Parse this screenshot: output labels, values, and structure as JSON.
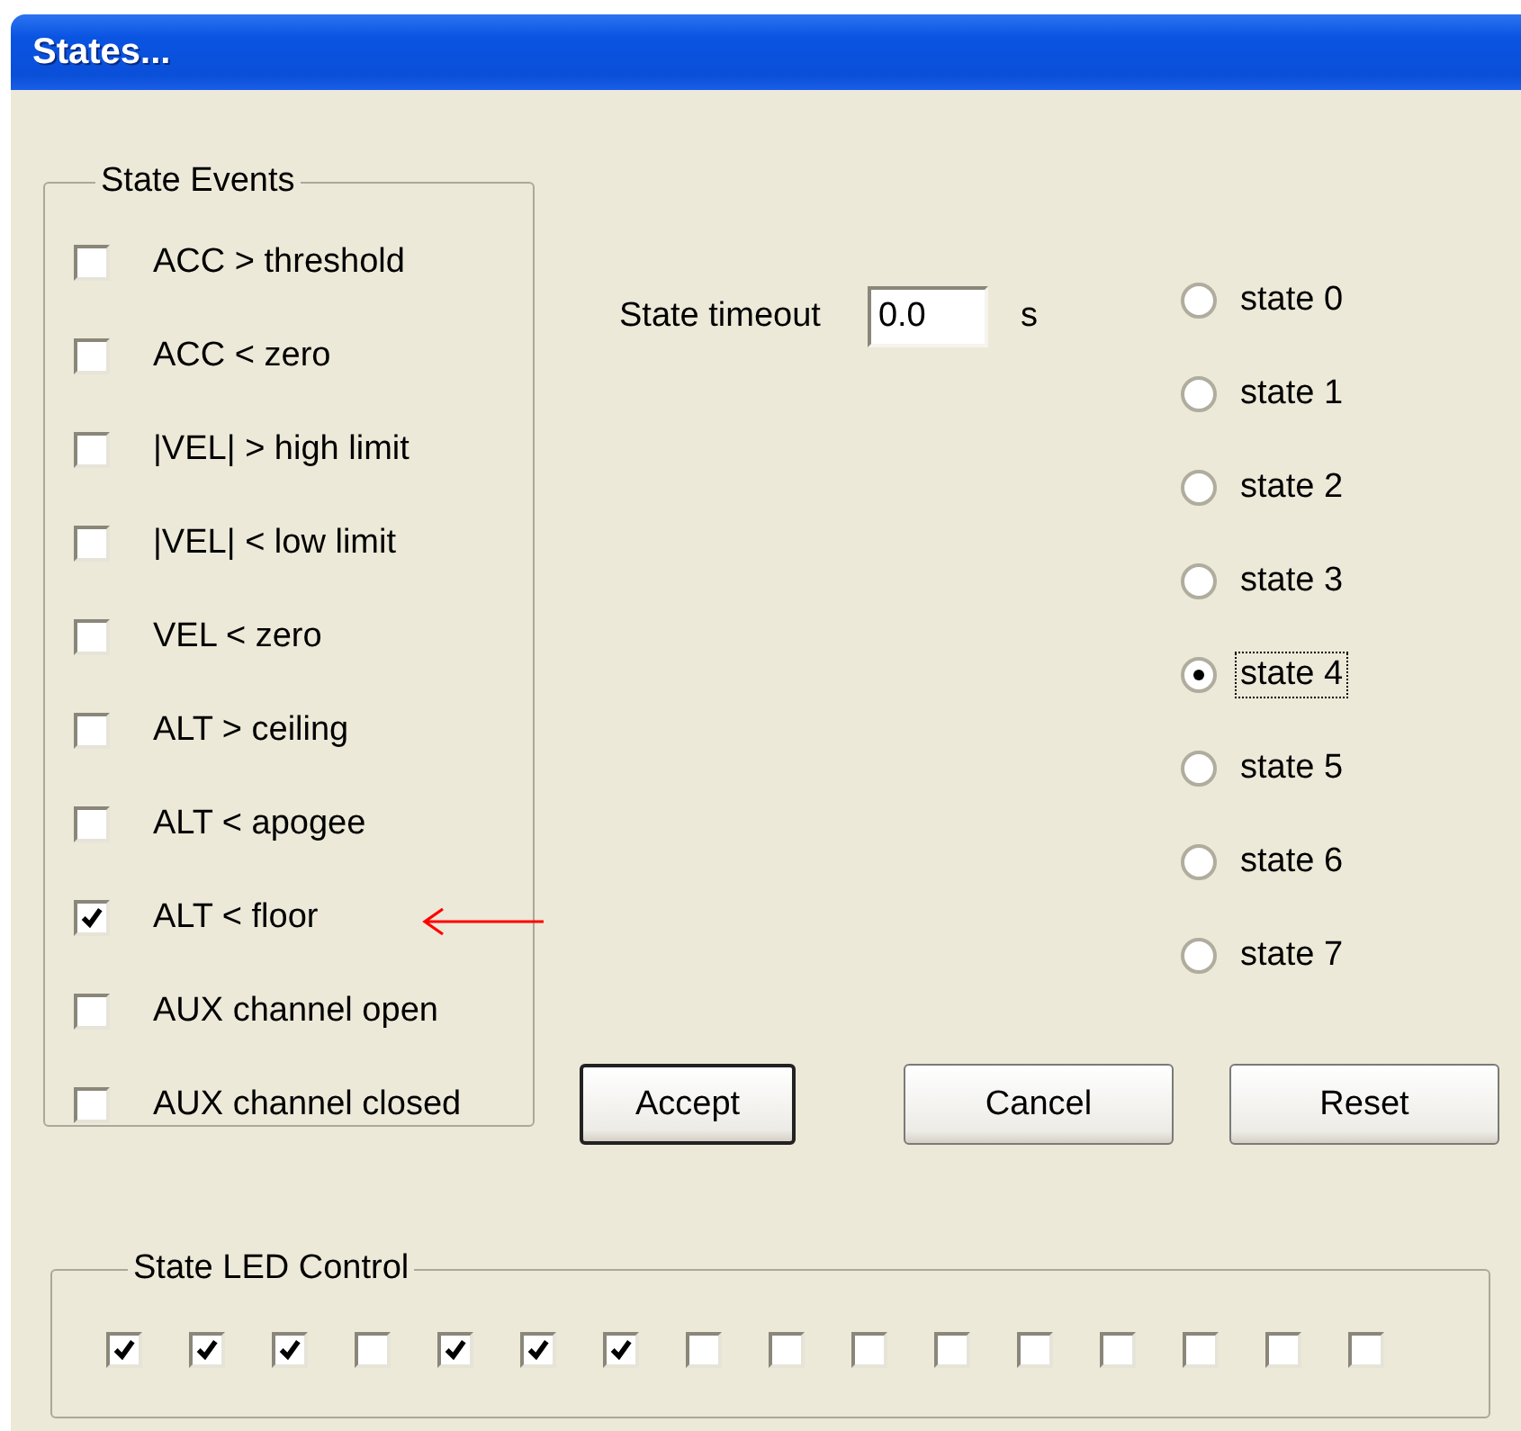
{
  "window": {
    "title": "States..."
  },
  "state_events": {
    "title": "State Events",
    "items": [
      {
        "label": "ACC > threshold",
        "checked": false
      },
      {
        "label": "ACC < zero",
        "checked": false
      },
      {
        "label": "|VEL| > high limit",
        "checked": false
      },
      {
        "label": "|VEL| < low limit",
        "checked": false
      },
      {
        "label": "VEL < zero",
        "checked": false
      },
      {
        "label": "ALT > ceiling",
        "checked": false
      },
      {
        "label": "ALT < apogee",
        "checked": false
      },
      {
        "label": "ALT < floor",
        "checked": true
      },
      {
        "label": "AUX channel open",
        "checked": false
      },
      {
        "label": "AUX channel closed",
        "checked": false
      }
    ]
  },
  "timeout": {
    "label": "State timeout",
    "value": "0.0",
    "unit": "s"
  },
  "states": [
    {
      "label": "state 0",
      "selected": false,
      "focused": false
    },
    {
      "label": "state 1",
      "selected": false,
      "focused": false
    },
    {
      "label": "state 2",
      "selected": false,
      "focused": false
    },
    {
      "label": "state 3",
      "selected": false,
      "focused": false
    },
    {
      "label": "state 4",
      "selected": true,
      "focused": true
    },
    {
      "label": "state 5",
      "selected": false,
      "focused": false
    },
    {
      "label": "state 6",
      "selected": false,
      "focused": false
    },
    {
      "label": "state 7",
      "selected": false,
      "focused": false
    }
  ],
  "buttons": [
    {
      "label": "Accept",
      "default": true
    },
    {
      "label": "Cancel",
      "default": false
    },
    {
      "label": "Reset",
      "default": false
    }
  ],
  "led_control": {
    "title": "State LED Control",
    "leds": [
      {
        "checked": true
      },
      {
        "checked": true
      },
      {
        "checked": true
      },
      {
        "checked": false
      },
      {
        "checked": true
      },
      {
        "checked": true
      },
      {
        "checked": true
      },
      {
        "checked": false
      },
      {
        "checked": false
      },
      {
        "checked": false
      },
      {
        "checked": false
      },
      {
        "checked": false
      },
      {
        "checked": false
      },
      {
        "checked": false
      },
      {
        "checked": false
      },
      {
        "checked": false
      }
    ]
  }
}
